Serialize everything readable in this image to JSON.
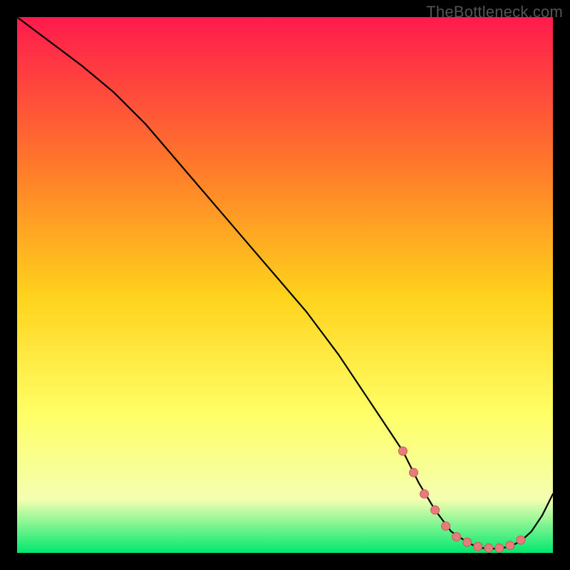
{
  "watermark": "TheBottleneck.com",
  "colors": {
    "frame_background": "#000000",
    "gradient_top": "#ff1a4d",
    "gradient_mid_upper": "#ff7a2a",
    "gradient_mid": "#ffd21c",
    "gradient_mid_lower": "#ffff66",
    "gradient_low": "#f4ffb0",
    "gradient_bottom": "#00e86f",
    "curve": "#000000",
    "marker_fill": "#e77a7a",
    "marker_stroke": "#c95b5b"
  },
  "chart_data": {
    "type": "line",
    "title": "",
    "xlabel": "",
    "ylabel": "",
    "xlim": [
      0,
      100
    ],
    "ylim": [
      0,
      100
    ],
    "series": [
      {
        "name": "bottleneck-curve",
        "x": [
          0,
          4,
          8,
          12,
          18,
          24,
          30,
          36,
          42,
          48,
          54,
          60,
          64,
          68,
          72,
          75,
          78,
          81,
          84,
          86,
          88,
          90,
          92,
          94,
          96,
          98,
          100
        ],
        "y": [
          100,
          97,
          94,
          91,
          86,
          80,
          73,
          66,
          59,
          52,
          45,
          37,
          31,
          25,
          19,
          13,
          8,
          4,
          2,
          1,
          0.8,
          0.8,
          1.2,
          2.2,
          4,
          7,
          11
        ]
      }
    ],
    "markers": {
      "name": "fit-region",
      "x": [
        72,
        74,
        76,
        78,
        80,
        82,
        84,
        86,
        88,
        90,
        92,
        94
      ],
      "y": [
        19,
        15,
        11,
        8,
        5,
        3,
        2,
        1.2,
        0.9,
        0.9,
        1.4,
        2.4
      ]
    }
  }
}
